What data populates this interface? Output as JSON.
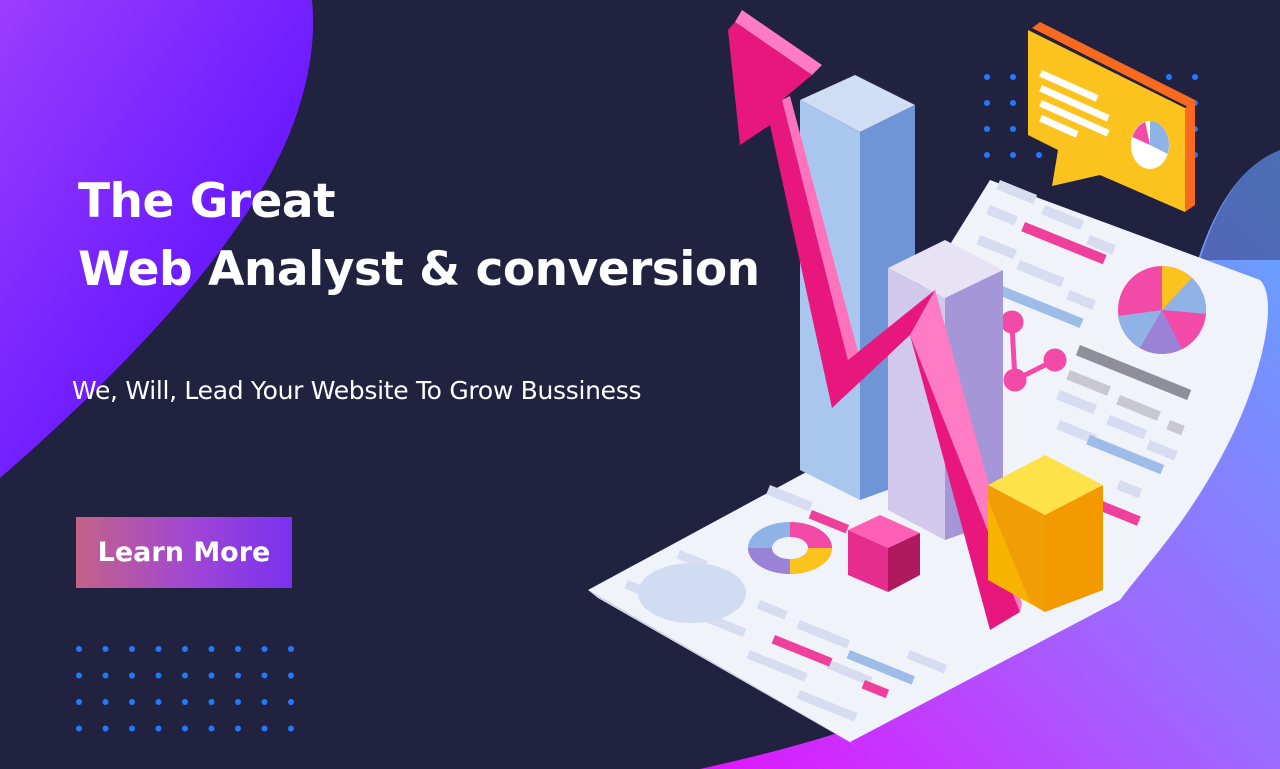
{
  "hero": {
    "headline_line1": "The Great",
    "headline_line2": "Web Analyst & conversion",
    "tagline": "We, Will, Lead Your Website To Grow Bussiness",
    "cta_label": "Learn More"
  },
  "colors": {
    "background": "#212140",
    "accent_purple": "#7a1bff",
    "accent_pink": "#e8177d",
    "accent_yellow": "#fcc31f",
    "dot_blue": "#1e7bff"
  },
  "icons": [
    "analytics-illustration",
    "growth-arrow-icon",
    "pie-chart-icon",
    "speech-bubble-icon"
  ]
}
